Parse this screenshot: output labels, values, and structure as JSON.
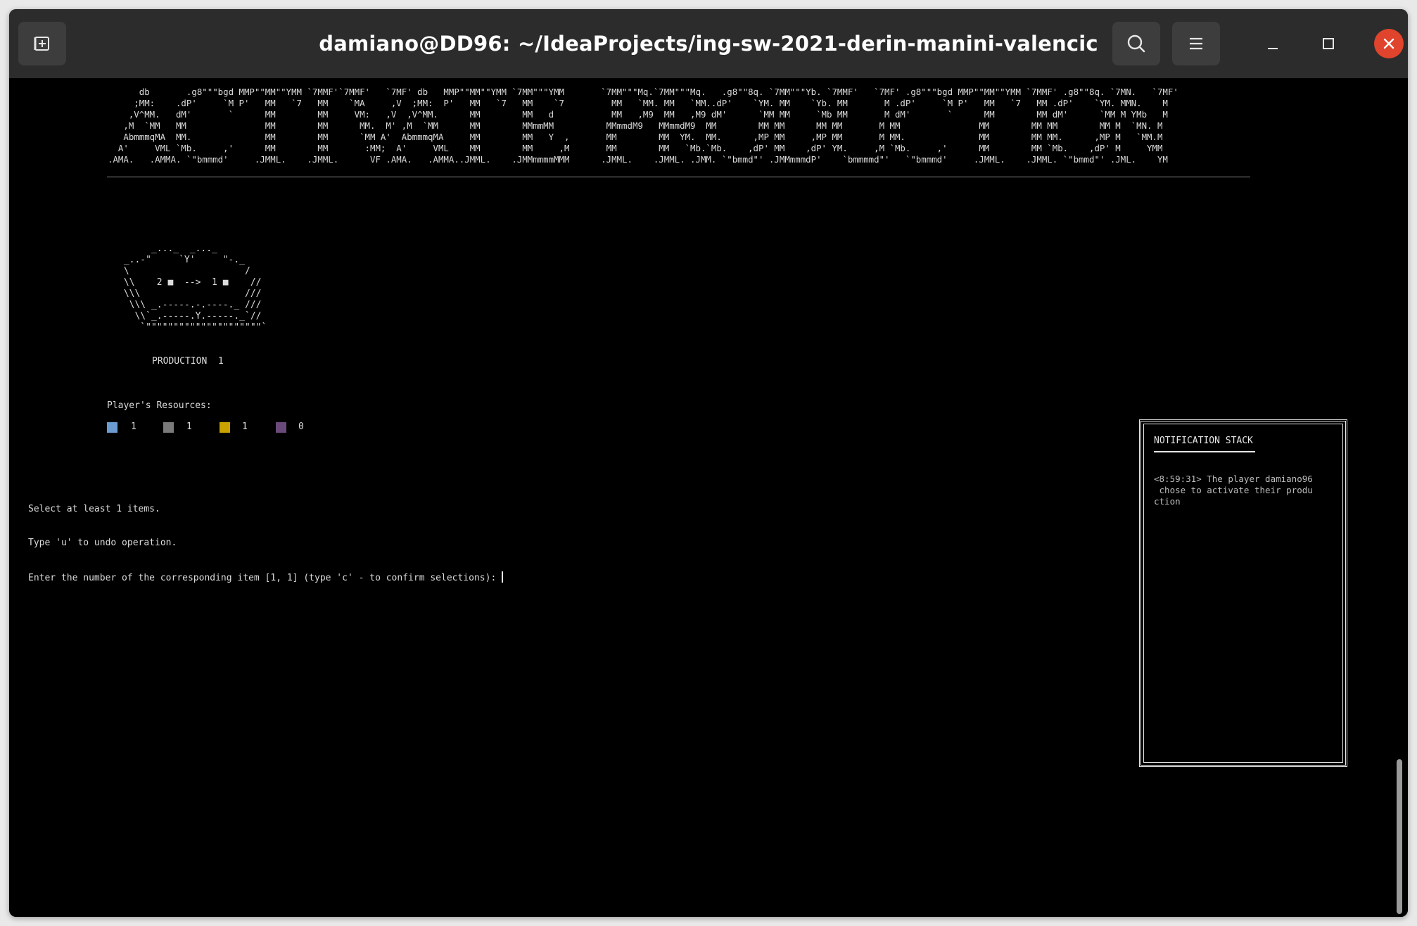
{
  "window": {
    "title": "damiano@DD96: ~/IdeaProjects/ing-sw-2021-derin-manini-valencic"
  },
  "terminal": {
    "banner_ascii": "      db       .g8\"\"\"bgd MMP\"\"MM\"\"YMM `7MMF'`7MMF'   `7MF' db   MMP\"\"MM\"\"YMM `7MM\"\"\"YMM       `7MM\"\"\"Mq.`7MM\"\"\"Mq.   .g8\"\"8q. `7MM\"\"\"Yb. `7MMF'   `7MF' .g8\"\"\"bgd MMP\"\"MM\"\"YMM `7MMF' .g8\"\"8q. `7MN.   `7MF'\n     ;MM:    .dP'     `M P'   MM   `7   MM    `MA     ,V  ;MM:  P'   MM   `7   MM    `7         MM   `MM. MM   `MM..dP'    `YM. MM    `Yb. MM       M .dP'     `M P'   MM   `7   MM .dP'    `YM. MMN.    M\n    ,V^MM.   dM'       `      MM        MM     VM:   ,V  ,V^MM.      MM        MM   d           MM   ,M9  MM   ,M9 dM'      `MM MM     `Mb MM       M dM'       `      MM        MM dM'      `MM M YMb   M\n   ,M  `MM   MM               MM        MM      MM.  M' ,M  `MM      MM        MMmmMM          MMmmdM9   MMmmdM9  MM        MM MM      MM MM       M MM               MM        MM MM        MM M  `MN. M\n   AbmmmqMA  MM.              MM        MM      `MM A'  AbmmmqMA     MM        MM   Y  ,       MM        MM  YM.  MM.      ,MP MM     ,MP MM       M MM.              MM        MM MM.      ,MP M   `MM.M\n  A'     VML `Mb.     ,'      MM        MM       :MM;  A'     VML    MM        MM     ,M       MM        MM   `Mb.`Mb.    ,dP' MM    ,dP' YM.     ,M `Mb.     ,'      MM        MM `Mb.    ,dP' M     YMM\n.AMA.   .AMMA. `\"bmmmd'     .JMML.    .JMML.      VF .AMA.   .AMMA..JMML.    .JMMmmmmMMM      .JMML.    .JMML. .JMM. `\"bmmd\"' .JMMmmmdP'    `bmmmmd\"'   `\"bmmmd'     .JMML.    .JMML. `\"bmmd\"' .JML.    YM",
    "card_ascii": "      _..._  _..._\n _..-\"     `Y'     \"-._\n \\                     /\n \\\\    2 ■  -->  1 ■    //\n \\\\\\                   ///\n  \\\\\\ _.-----.-.----._ ///\n   \\\\`_.-----.Y.-----._`//\n    `\"\"\"\"\"\"\"\"\"\"\"\"\"\"\"\"\"\"\"\"\"`",
    "production_label": "PRODUCTION  1",
    "resources_label": "Player's Resources:",
    "resources": [
      {
        "color": "#6b9bd2",
        "count": "1"
      },
      {
        "color": "#7a7a7a",
        "count": "1"
      },
      {
        "color": "#c9a100",
        "count": "1"
      },
      {
        "color": "#6a4a7a",
        "count": "0"
      }
    ],
    "prompt_lines": [
      "Select at least 1 items.",
      "Type 'u' to undo operation.",
      "Enter the number of the corresponding item [1, 1] (type 'c' - to confirm selections): "
    ]
  },
  "notifications": {
    "title": "NOTIFICATION STACK",
    "message": "<8:59:31> The player damiano96\n chose to activate their produ\nction"
  }
}
